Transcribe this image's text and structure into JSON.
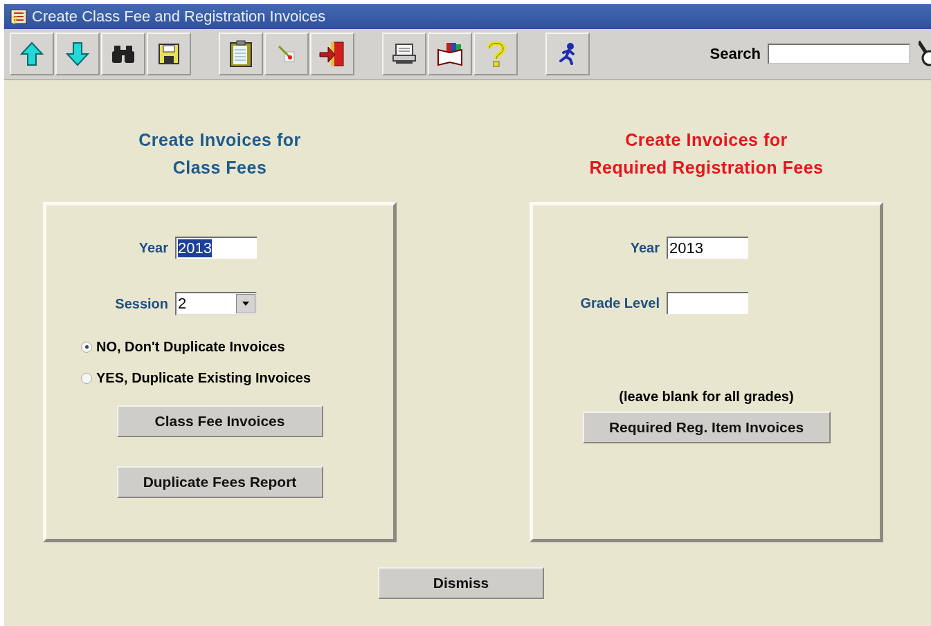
{
  "window": {
    "title": "Create Class Fee and Registration Invoices"
  },
  "toolbar": {
    "groups": [
      [
        {
          "kind": "up"
        },
        {
          "kind": "down"
        },
        {
          "kind": "find"
        },
        {
          "kind": "save"
        }
      ],
      [
        {
          "kind": "clipboard"
        },
        {
          "kind": "wand"
        },
        {
          "kind": "exit"
        }
      ],
      [
        {
          "kind": "print"
        },
        {
          "kind": "book"
        },
        {
          "kind": "help"
        }
      ],
      [
        {
          "kind": "run"
        }
      ]
    ],
    "search": {
      "label": "Search"
    }
  },
  "class_fees": {
    "heading": [
      "Create Invoices for",
      "Class Fees"
    ],
    "color": "#1f5a8c",
    "year": {
      "label": "Year",
      "value": "2013",
      "highlighted": true
    },
    "session": {
      "label": "Session",
      "value": "2"
    },
    "options": [
      {
        "label": "NO, Don't Duplicate Invoices",
        "selected": true
      },
      {
        "label": "YES, Duplicate Existing Invoices",
        "selected": false
      }
    ],
    "buttons": [
      "Class Fee Invoices",
      "Duplicate Fees Report"
    ]
  },
  "registration_fees": {
    "heading": [
      "Create Invoices for",
      "Required Registration Fees"
    ],
    "color": "#e8141c",
    "year": {
      "label": "Year",
      "value": "2013",
      "highlighted": false
    },
    "grade_level": {
      "label": "Grade Level"
    },
    "hint": "(leave blank for all grades)",
    "button": "Required Reg. Item Invoices"
  },
  "dismiss": "Dismiss"
}
